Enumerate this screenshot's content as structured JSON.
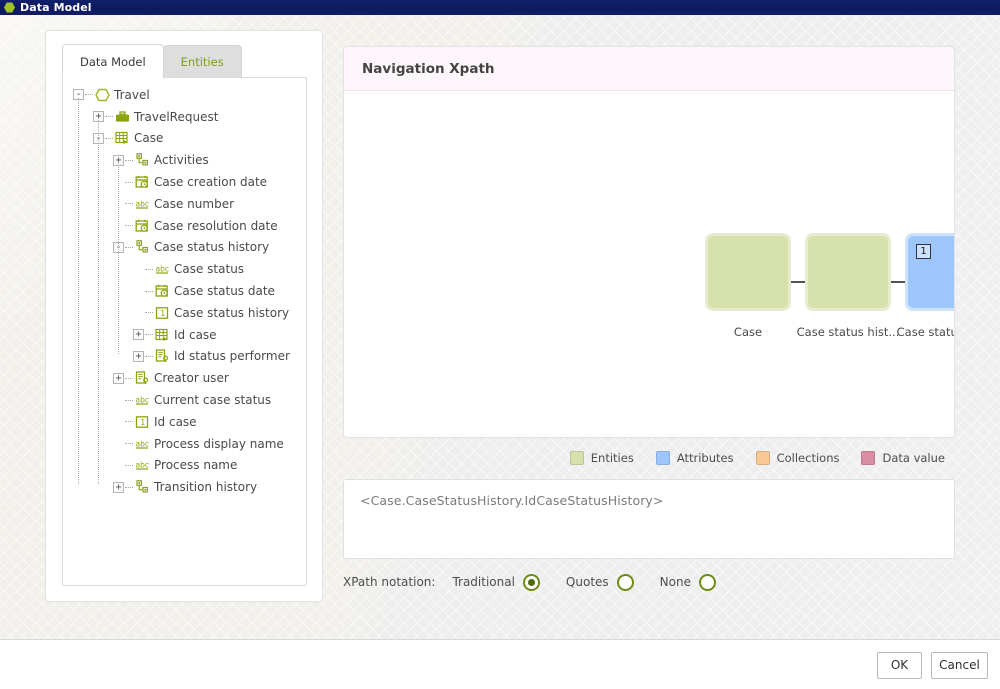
{
  "window": {
    "title": "Data Model",
    "icon": "hexagon-icon"
  },
  "tabs": [
    {
      "label": "Data Model",
      "active": true
    },
    {
      "label": "Entities",
      "active": false
    }
  ],
  "tree": {
    "nodes": [
      {
        "label": "Travel",
        "depth": 0,
        "toggle": "-",
        "icon": "hexagon-icon"
      },
      {
        "label": "TravelRequest",
        "depth": 1,
        "toggle": "+",
        "icon": "briefcase-icon"
      },
      {
        "label": "Case",
        "depth": 1,
        "toggle": "-",
        "icon": "table-process-icon"
      },
      {
        "label": "Activities",
        "depth": 2,
        "toggle": "+",
        "icon": "collection-icon"
      },
      {
        "label": "Case creation date",
        "depth": 2,
        "toggle": "",
        "icon": "calendar-clock-icon"
      },
      {
        "label": "Case number",
        "depth": 2,
        "toggle": "",
        "icon": "abc-icon"
      },
      {
        "label": "Case resolution date",
        "depth": 2,
        "toggle": "",
        "icon": "calendar-clock-icon"
      },
      {
        "label": "Case status history",
        "depth": 2,
        "toggle": "-",
        "icon": "collection-icon"
      },
      {
        "label": "Case status",
        "depth": 3,
        "toggle": "",
        "icon": "abc-icon"
      },
      {
        "label": "Case status date",
        "depth": 3,
        "toggle": "",
        "icon": "calendar-clock-icon"
      },
      {
        "label": "Case status history",
        "depth": 3,
        "toggle": "",
        "icon": "number-icon"
      },
      {
        "label": "Id case",
        "depth": 3,
        "toggle": "+",
        "icon": "table-process-icon"
      },
      {
        "label": "Id status performer",
        "depth": 3,
        "toggle": "+",
        "icon": "user-record-icon"
      },
      {
        "label": "Creator user",
        "depth": 2,
        "toggle": "+",
        "icon": "user-record-icon"
      },
      {
        "label": "Current case status",
        "depth": 2,
        "toggle": "",
        "icon": "abc-icon"
      },
      {
        "label": "Id case",
        "depth": 2,
        "toggle": "",
        "icon": "number-icon"
      },
      {
        "label": "Process display name",
        "depth": 2,
        "toggle": "",
        "icon": "abc-icon"
      },
      {
        "label": "Process name",
        "depth": 2,
        "toggle": "",
        "icon": "abc-icon"
      },
      {
        "label": "Transition history",
        "depth": 2,
        "toggle": "+",
        "icon": "collection-icon"
      }
    ]
  },
  "navigation": {
    "title": "Navigation Xpath",
    "nodes": [
      {
        "label": "Case",
        "type": "entity",
        "badge": ""
      },
      {
        "label": "Case status hist...",
        "type": "entity",
        "badge": ""
      },
      {
        "label": "Case status hist...",
        "type": "attribute",
        "badge": "1"
      }
    ]
  },
  "legend": [
    {
      "label": "Entities",
      "color": "#d7e1ab"
    },
    {
      "label": "Attributes",
      "color": "#9cc6fc"
    },
    {
      "label": "Collections",
      "color": "#f7c894"
    },
    {
      "label": "Data value",
      "color": "#d98da3"
    }
  ],
  "xpath": {
    "value": "<Case.CaseStatusHistory.IdCaseStatusHistory>"
  },
  "notation": {
    "label": "XPath notation:",
    "options": [
      {
        "label": "Traditional",
        "selected": true
      },
      {
        "label": "Quotes",
        "selected": false
      },
      {
        "label": "None",
        "selected": false
      }
    ]
  },
  "footer": {
    "ok_label": "OK",
    "cancel_label": "Cancel"
  }
}
